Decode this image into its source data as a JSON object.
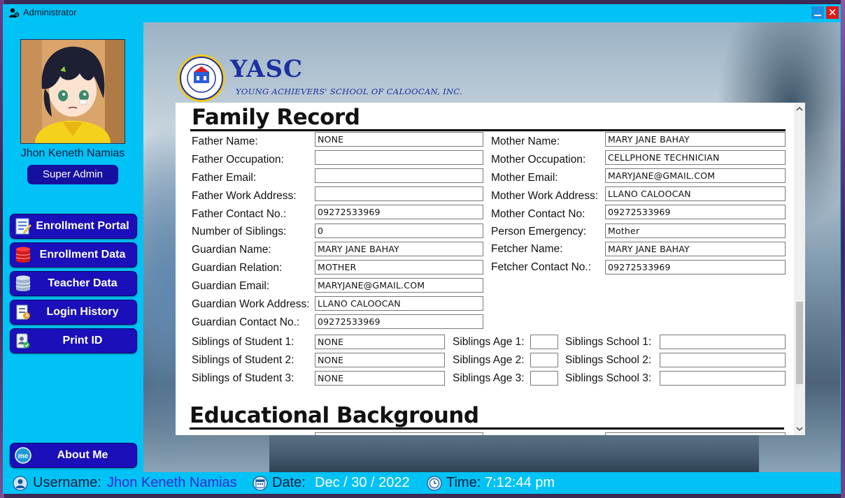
{
  "window": {
    "title": "Administrator",
    "minimize": "minimize",
    "close": "✕"
  },
  "sidebar": {
    "user_name": "Jhon Keneth Namias",
    "role": "Super Admin",
    "nav": [
      {
        "label": "Enrollment Portal",
        "icon": "enrollment-portal-icon"
      },
      {
        "label": "Enrollment Data",
        "icon": "database-icon"
      },
      {
        "label": "Teacher Data",
        "icon": "teacher-data-icon"
      },
      {
        "label": "Login History",
        "icon": "login-history-icon"
      },
      {
        "label": "Print ID",
        "icon": "print-id-icon"
      }
    ],
    "about": {
      "label": "About Me",
      "icon": "me-icon",
      "icon_text": "me"
    }
  },
  "brand": {
    "name": "YASC",
    "subtitle": "YOUNG ACHIEVERS' SCHOOL OF CALOOCAN, INC."
  },
  "family": {
    "title": "Family Record",
    "left": [
      {
        "label": "Father Name:",
        "value": "NONE"
      },
      {
        "label": "Father Occupation:",
        "value": ""
      },
      {
        "label": "Father Email:",
        "value": ""
      },
      {
        "label": "Father Work Address:",
        "value": ""
      },
      {
        "label": "Father Contact No.:",
        "value": "09272533969"
      },
      {
        "label": "Number of Siblings:",
        "value": "0"
      },
      {
        "label": "Guardian Name:",
        "value": "MARY JANE BAHAY"
      },
      {
        "label": "Guardian Relation:",
        "value": "MOTHER"
      },
      {
        "label": "Guardian Email:",
        "value": "MARYJANE@GMAIL.COM"
      },
      {
        "label": "Guardian Work Address:",
        "value": "LLANO CALOOCAN"
      },
      {
        "label": "Guardian Contact No.:",
        "value": "09272533969"
      }
    ],
    "right": [
      {
        "label": "Mother Name:",
        "value": "MARY JANE BAHAY"
      },
      {
        "label": "Mother Occupation:",
        "value": "CELLPHONE TECHNICIAN"
      },
      {
        "label": "Mother Email:",
        "value": "MARYJANE@GMAIL.COM"
      },
      {
        "label": "Mother Work Address:",
        "value": "LLANO CALOOCAN"
      },
      {
        "label": "Mother Contact No:",
        "value": "09272533969"
      },
      {
        "label": "Person Emergency:",
        "value": "Mother"
      },
      {
        "label": "Fetcher Name:",
        "value": "MARY JANE BAHAY"
      },
      {
        "label": "Fetcher Contact No.:",
        "value": "09272533969"
      }
    ],
    "siblings": [
      {
        "label": "Siblings of Student 1:",
        "value": "NONE",
        "age_label": "Siblings Age 1:",
        "age": "",
        "school_label": "Siblings School 1:",
        "school": ""
      },
      {
        "label": "Siblings of Student 2:",
        "value": "NONE",
        "age_label": "Siblings Age 2:",
        "age": "",
        "school_label": "Siblings School 2:",
        "school": ""
      },
      {
        "label": "Siblings of Student 3:",
        "value": "NONE",
        "age_label": "Siblings Age 3:",
        "age": "",
        "school_label": "Siblings School 3:",
        "school": ""
      }
    ]
  },
  "education": {
    "title": "Educational Background"
  },
  "status": {
    "username_label": "Username:",
    "username": "Jhon Keneth Namias",
    "date_label": "Date:",
    "date": "Dec / 30 / 2022",
    "time_label": "Time:",
    "time": "7:12:44 pm",
    "username_color": "#3a2bd0",
    "value_color": "#ffffff"
  }
}
